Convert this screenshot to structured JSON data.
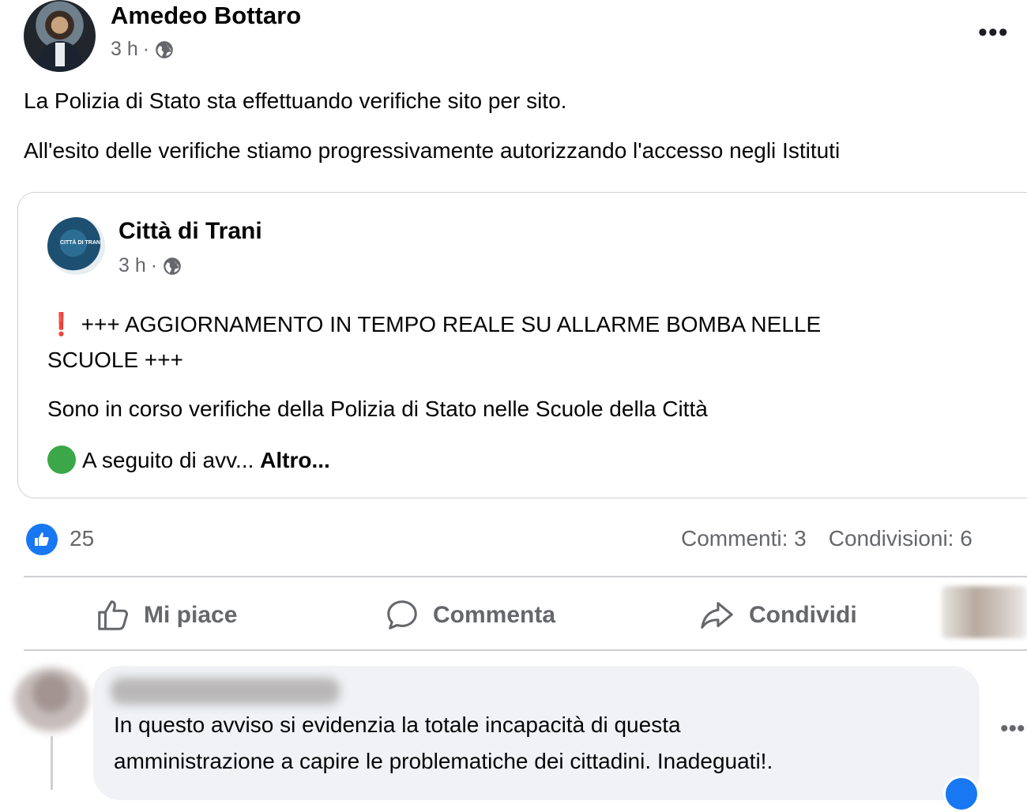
{
  "post": {
    "author": "Amedeo Bottaro",
    "time": "3 h",
    "separator": "·",
    "more": "•••",
    "lines": [
      "La Polizia di Stato sta effettuando verifiche sito per sito.",
      "All'esito delle verifiche stiamo progressivamente autorizzando l'accesso negli Istituti"
    ]
  },
  "shared": {
    "page_name": "Città di Trani",
    "avatar_text": "CITTÀ DI TRANI",
    "time": "3 h",
    "separator": "·",
    "exclamation": "❗",
    "headline_1": "+++ AGGIORNAMENTO IN TEMPO REALE SU ALLARME BOMBA NELLE",
    "headline_2": "SCUOLE +++",
    "line_3": "Sono in corso verifiche della Polizia di Stato nelle Scuole della Città",
    "line_4": "A seguito di avv...",
    "more_link": "Altro..."
  },
  "stats": {
    "likes": "25",
    "comments": "Commenti: 3",
    "shares": "Condivisioni: 6"
  },
  "actions": {
    "like": "Mi piace",
    "comment": "Commenta",
    "share": "Condividi"
  },
  "comment": {
    "text_1": "In questo avviso si evidenzia la totale incapacità di questa",
    "text_2": "amministrazione a capire le problematiche dei cittadini. Inadeguati!.",
    "more": "•••"
  },
  "colors": {
    "accent": "#1877f2",
    "muted": "#65676b",
    "bubble": "#f0f2f5",
    "green_dot": "#3ba748",
    "exclamation": "#e4202b"
  }
}
